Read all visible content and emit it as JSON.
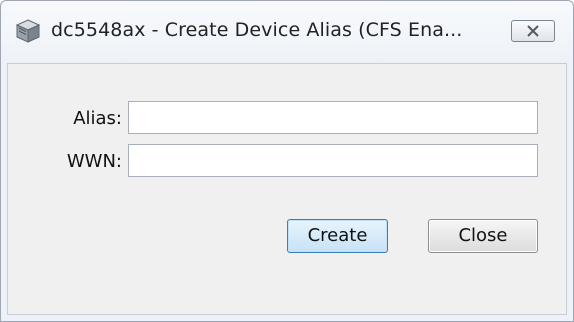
{
  "window": {
    "title": "dc5548ax - Create Device Alias (CFS Ena...",
    "app_icon": "device-cube-icon",
    "close_icon": "close-x-icon"
  },
  "form": {
    "alias_label": "Alias:",
    "alias_value": "",
    "wwn_label": "WWN:",
    "wwn_value": ""
  },
  "buttons": {
    "create_label": "Create",
    "close_label": "Close"
  },
  "colors": {
    "window_bg": "#eef2f8",
    "content_bg": "#f0f0f0",
    "default_button_border": "#3c7fb1"
  }
}
